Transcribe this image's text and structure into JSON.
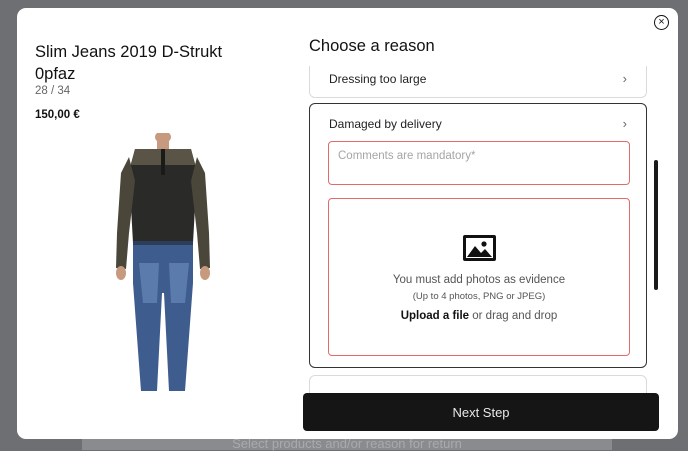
{
  "background": {
    "hint_text": "Select products and/or reason for return"
  },
  "product": {
    "title": "Slim Jeans 2019 D-Strukt 0pfaz",
    "size": "28 / 34",
    "price": "150,00 €"
  },
  "reason": {
    "title": "Choose a reason",
    "items": [
      {
        "label": "Dressing too large"
      },
      {
        "label": "Damaged by delivery"
      }
    ],
    "comments_placeholder": "Comments are mandatory*",
    "upload": {
      "evidence_text": "You must add photos as evidence",
      "hint": "(Up to 4 photos, PNG or JPEG)",
      "link": "Upload a file",
      "rest": "or drag and drop"
    }
  },
  "actions": {
    "next_step": "Next Step",
    "close_glyph": "×"
  },
  "colors": {
    "accent_dark": "#151515",
    "error_border": "#e06b6b"
  }
}
